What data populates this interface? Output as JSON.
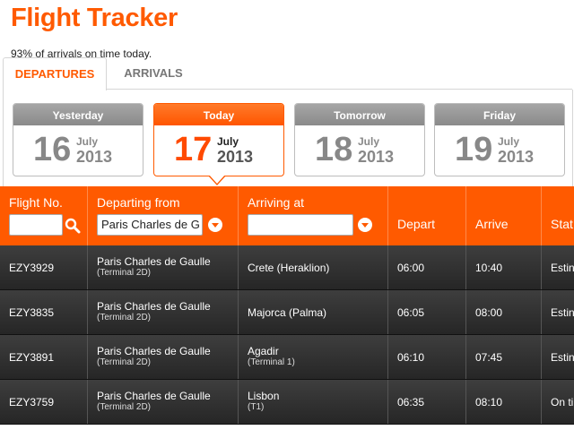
{
  "header": {
    "title": "Flight Tracker",
    "subtitle": "93% of arrivals on time today."
  },
  "tabs": [
    {
      "label": "DEPARTURES",
      "active": true
    },
    {
      "label": "ARRIVALS",
      "active": false
    }
  ],
  "dates": [
    {
      "label": "Yesterday",
      "day": "16",
      "month": "July",
      "year": "2013",
      "active": false
    },
    {
      "label": "Today",
      "day": "17",
      "month": "July",
      "year": "2013",
      "active": true
    },
    {
      "label": "Tomorrow",
      "day": "18",
      "month": "July",
      "year": "2013",
      "active": false
    },
    {
      "label": "Friday",
      "day": "19",
      "month": "July",
      "year": "2013",
      "active": false
    }
  ],
  "table": {
    "columns": {
      "flight_no": "Flight No.",
      "departing_from": "Departing from",
      "arriving_at": "Arriving at",
      "depart": "Depart",
      "arrive": "Arrive",
      "status": "Stat"
    },
    "filters": {
      "flight_no_value": "",
      "departing_value": "Paris Charles de G",
      "arriving_value": ""
    },
    "rows": [
      {
        "flight": "EZY3929",
        "from": "Paris Charles de Gaulle",
        "from_sub": "(Terminal 2D)",
        "to": "Crete (Heraklion)",
        "to_sub": "",
        "depart": "06:00",
        "arrive": "10:40",
        "status": "Estin"
      },
      {
        "flight": "EZY3835",
        "from": "Paris Charles de Gaulle",
        "from_sub": "(Terminal 2D)",
        "to": "Majorca (Palma)",
        "to_sub": "",
        "depart": "06:05",
        "arrive": "08:00",
        "status": "Estin"
      },
      {
        "flight": "EZY3891",
        "from": "Paris Charles de Gaulle",
        "from_sub": "(Terminal 2D)",
        "to": "Agadir",
        "to_sub": "(Terminal 1)",
        "depart": "06:10",
        "arrive": "07:45",
        "status": "Estin"
      },
      {
        "flight": "EZY3759",
        "from": "Paris Charles de Gaulle",
        "from_sub": "(Terminal 2D)",
        "to": "Lisbon",
        "to_sub": "(T1)",
        "depart": "06:35",
        "arrive": "08:10",
        "status": "On ti"
      }
    ]
  },
  "colors": {
    "accent": "#ff5a00",
    "row_bg": "#2f2f2f",
    "inactive_card": "#999999"
  }
}
